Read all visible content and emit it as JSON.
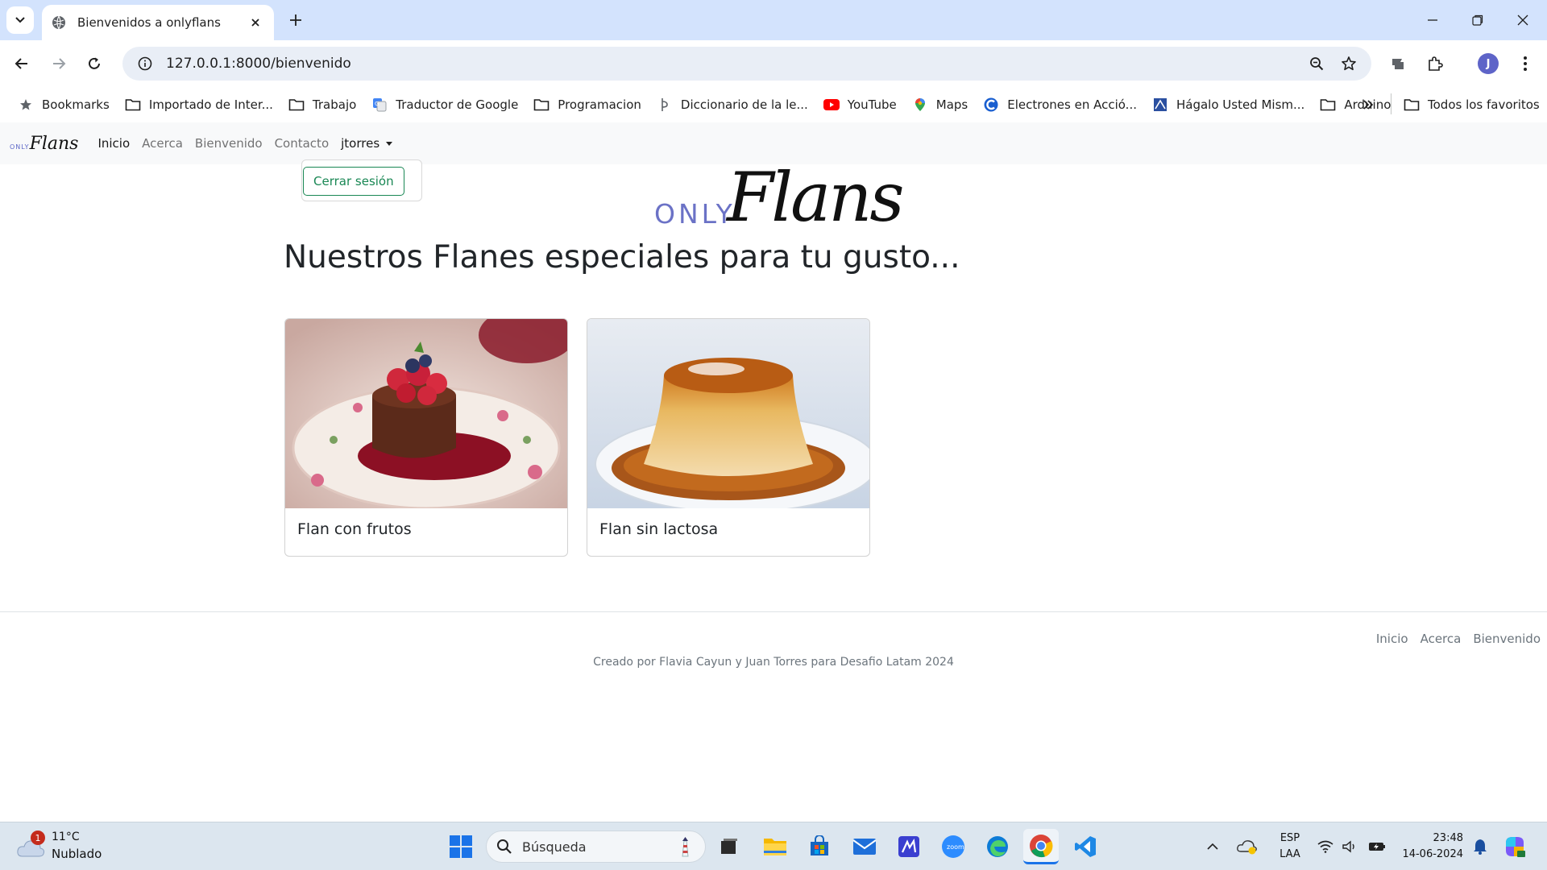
{
  "browser": {
    "tab_title": "Bienvenidos a onlyflans",
    "url": "127.0.0.1:8000/bienvenido",
    "profile_initial": "J",
    "bookmarks": [
      {
        "label": "Bookmarks",
        "icon": "star-icon"
      },
      {
        "label": "Importado de Inter...",
        "icon": "folder-icon"
      },
      {
        "label": "Trabajo",
        "icon": "folder-icon"
      },
      {
        "label": "Traductor de Google",
        "icon": "google-translate-icon"
      },
      {
        "label": "Programacion",
        "icon": "folder-icon"
      },
      {
        "label": "Diccionario de la le...",
        "icon": "rae-icon"
      },
      {
        "label": "YouTube",
        "icon": "youtube-icon"
      },
      {
        "label": "Maps",
        "icon": "maps-pin-icon"
      },
      {
        "label": "Electrones en Acció...",
        "icon": "electrones-icon"
      },
      {
        "label": "Hágalo Usted Mism...",
        "icon": "hagalo-icon"
      },
      {
        "label": "Arduino",
        "icon": "folder-icon"
      }
    ],
    "all_bookmarks_label": "Todos los favoritos"
  },
  "site": {
    "brand_only": "ONLY",
    "brand_flans": "Flans",
    "nav": {
      "home": "Inicio",
      "about": "Acerca",
      "welcome": "Bienvenido",
      "contact": "Contacto",
      "user": "jtorres"
    },
    "dropdown": {
      "logout": "Cerrar sesión"
    },
    "hero": {
      "only": "ONLY",
      "flans": "Flans"
    },
    "heading": "Nuestros Flanes especiales para tu gusto...",
    "cards": [
      {
        "title": "Flan con frutos"
      },
      {
        "title": "Flan sin lactosa"
      }
    ],
    "footer": {
      "links": [
        "Inicio",
        "Acerca",
        "Bienvenido"
      ],
      "credit": "Creado por Flavia Cayun y Juan Torres para Desafio Latam 2024"
    }
  },
  "taskbar": {
    "weather_temp": "11°C",
    "weather_desc": "Nublado",
    "weather_badge": "1",
    "search_placeholder": "Búsqueda",
    "lang_top": "ESP",
    "lang_bottom": "LAA",
    "time": "23:48",
    "date": "14-06-2024"
  },
  "colors": {
    "brand_accent": "#6b72c6",
    "logout_green": "#198754",
    "tabstrip": "#d3e3fd",
    "taskbar": "#dce6ef"
  }
}
